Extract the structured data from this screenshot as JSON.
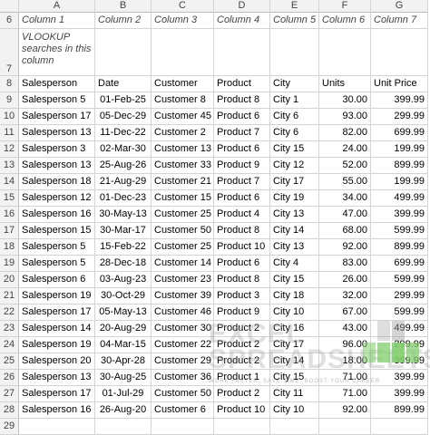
{
  "columns": [
    "A",
    "B",
    "C",
    "D",
    "E",
    "F",
    "G"
  ],
  "row6": [
    "Column 1",
    "Column 2",
    "Column 3",
    "Column 4",
    "Column 5",
    "Column 6",
    "Column 7"
  ],
  "row7_note": "VLOOKUP searches in this column",
  "headers": [
    "Salesperson",
    "Date",
    "Customer",
    "Product",
    "City",
    "Units",
    "Unit Price"
  ],
  "rows": [
    {
      "n": "9",
      "sp": "Salesperson 5",
      "date": "01-Feb-25",
      "cust": "Customer 8",
      "prod": "Product 8",
      "city": "City 1",
      "units": "30.00",
      "price": "399.99"
    },
    {
      "n": "10",
      "sp": "Salesperson 17",
      "date": "05-Dec-29",
      "cust": "Customer 45",
      "prod": "Product 6",
      "city": "City 6",
      "units": "93.00",
      "price": "299.99"
    },
    {
      "n": "11",
      "sp": "Salesperson 13",
      "date": "11-Dec-22",
      "cust": "Customer 2",
      "prod": "Product 7",
      "city": "City 6",
      "units": "82.00",
      "price": "699.99"
    },
    {
      "n": "12",
      "sp": "Salesperson 3",
      "date": "02-Mar-30",
      "cust": "Customer 13",
      "prod": "Product 6",
      "city": "City 15",
      "units": "24.00",
      "price": "199.99"
    },
    {
      "n": "13",
      "sp": "Salesperson 13",
      "date": "25-Aug-26",
      "cust": "Customer 33",
      "prod": "Product 9",
      "city": "City 12",
      "units": "52.00",
      "price": "899.99"
    },
    {
      "n": "14",
      "sp": "Salesperson 18",
      "date": "21-Aug-29",
      "cust": "Customer 21",
      "prod": "Product 7",
      "city": "City 17",
      "units": "55.00",
      "price": "199.99"
    },
    {
      "n": "15",
      "sp": "Salesperson 12",
      "date": "01-Dec-23",
      "cust": "Customer 15",
      "prod": "Product 6",
      "city": "City 19",
      "units": "34.00",
      "price": "499.99"
    },
    {
      "n": "16",
      "sp": "Salesperson 16",
      "date": "30-May-13",
      "cust": "Customer 25",
      "prod": "Product 4",
      "city": "City 13",
      "units": "47.00",
      "price": "399.99"
    },
    {
      "n": "17",
      "sp": "Salesperson 15",
      "date": "30-Mar-17",
      "cust": "Customer 50",
      "prod": "Product 8",
      "city": "City 14",
      "units": "68.00",
      "price": "599.99"
    },
    {
      "n": "18",
      "sp": "Salesperson 5",
      "date": "15-Feb-22",
      "cust": "Customer 25",
      "prod": "Product 10",
      "city": "City 13",
      "units": "92.00",
      "price": "899.99"
    },
    {
      "n": "19",
      "sp": "Salesperson 5",
      "date": "28-Dec-18",
      "cust": "Customer 14",
      "prod": "Product 6",
      "city": "City 4",
      "units": "83.00",
      "price": "699.99"
    },
    {
      "n": "20",
      "sp": "Salesperson 6",
      "date": "03-Aug-23",
      "cust": "Customer 23",
      "prod": "Product 8",
      "city": "City 15",
      "units": "26.00",
      "price": "599.99"
    },
    {
      "n": "21",
      "sp": "Salesperson 19",
      "date": "30-Oct-29",
      "cust": "Customer 39",
      "prod": "Product 3",
      "city": "City 18",
      "units": "32.00",
      "price": "299.99"
    },
    {
      "n": "22",
      "sp": "Salesperson 17",
      "date": "05-May-13",
      "cust": "Customer 46",
      "prod": "Product 9",
      "city": "City 10",
      "units": "67.00",
      "price": "599.99"
    },
    {
      "n": "23",
      "sp": "Salesperson 14",
      "date": "20-Aug-29",
      "cust": "Customer 30",
      "prod": "Product 2",
      "city": "City 16",
      "units": "43.00",
      "price": "499.99"
    },
    {
      "n": "24",
      "sp": "Salesperson 19",
      "date": "04-Mar-15",
      "cust": "Customer 22",
      "prod": "Product 2",
      "city": "City 17",
      "units": "96.00",
      "price": "299.99"
    },
    {
      "n": "25",
      "sp": "Salesperson 20",
      "date": "30-Apr-28",
      "cust": "Customer 29",
      "prod": "Product 2",
      "city": "City 14",
      "units": "18.00",
      "price": "399.99"
    },
    {
      "n": "26",
      "sp": "Salesperson 13",
      "date": "30-Aug-25",
      "cust": "Customer 36",
      "prod": "Product 1",
      "city": "City 15",
      "units": "71.00",
      "price": "399.99"
    },
    {
      "n": "27",
      "sp": "Salesperson 17",
      "date": "01-Jul-29",
      "cust": "Customer 50",
      "prod": "Product 2",
      "city": "City 11",
      "units": "71.00",
      "price": "399.99"
    },
    {
      "n": "28",
      "sp": "Salesperson 16",
      "date": "26-Aug-20",
      "cust": "Customer 6",
      "prod": "Product 10",
      "city": "City 10",
      "units": "92.00",
      "price": "899.99"
    }
  ],
  "watermark": {
    "line1": "EXCEL",
    "line2": "SPREADSHEETS",
    "tagline": "WORK FASTER, SAVE TIME, BOOST YOUR CAREER",
    "green": "#7fcf6a"
  }
}
